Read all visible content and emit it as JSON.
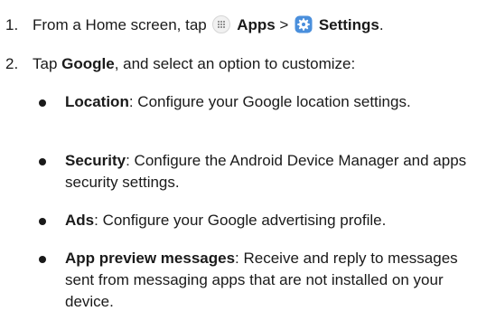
{
  "steps": [
    {
      "number": "1.",
      "pre": "From a Home screen, tap ",
      "apps_label": "Apps",
      "separator": " > ",
      "settings_label": "Settings",
      "post": "."
    },
    {
      "number": "2.",
      "pre": "Tap ",
      "google_label": "Google",
      "post": ", and select an option to customize:"
    }
  ],
  "options": [
    {
      "label": "Location",
      "description": ": Configure your Google location settings."
    },
    {
      "label": "Security",
      "description": ": Configure the Android Device Manager and apps security settings."
    },
    {
      "label": "Ads",
      "description": ": Configure your Google advertising profile."
    },
    {
      "label": "App preview messages",
      "description": ": Receive and reply to messages sent from messaging apps that are not installed on your device."
    }
  ],
  "icons": {
    "apps": "apps-grid-icon",
    "settings": "settings-gear-icon",
    "settings_color": "#4a8fdc"
  }
}
